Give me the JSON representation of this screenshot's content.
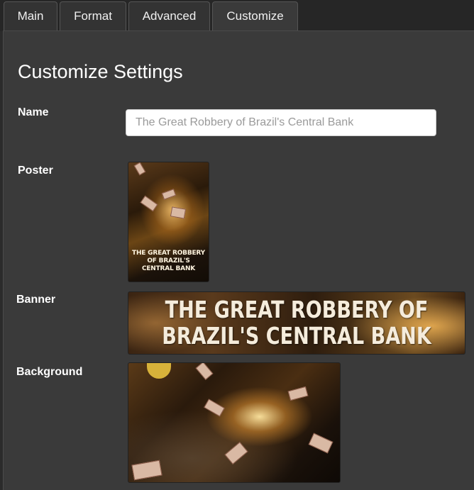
{
  "tabs": [
    {
      "label": "Main",
      "active": false
    },
    {
      "label": "Format",
      "active": false
    },
    {
      "label": "Advanced",
      "active": false
    },
    {
      "label": "Customize",
      "active": true
    }
  ],
  "page": {
    "title": "Customize Settings"
  },
  "fields": {
    "name_label": "Name",
    "name_value": "",
    "name_placeholder": "The Great Robbery of Brazil's Central Bank",
    "poster_label": "Poster",
    "banner_label": "Banner",
    "background_label": "Background"
  },
  "images": {
    "poster_text": "THE GREAT ROBBERY OF BRAZIL'S CENTRAL BANK",
    "banner_text": "THE GREAT ROBBERY OF BRAZIL'S CENTRAL BANK",
    "poster_icon": "poster-image",
    "banner_icon": "banner-image",
    "background_icon": "background-image"
  },
  "colors": {
    "panel_bg": "#3a3a3a",
    "tab_bg": "#333333",
    "text": "#ffffff"
  }
}
